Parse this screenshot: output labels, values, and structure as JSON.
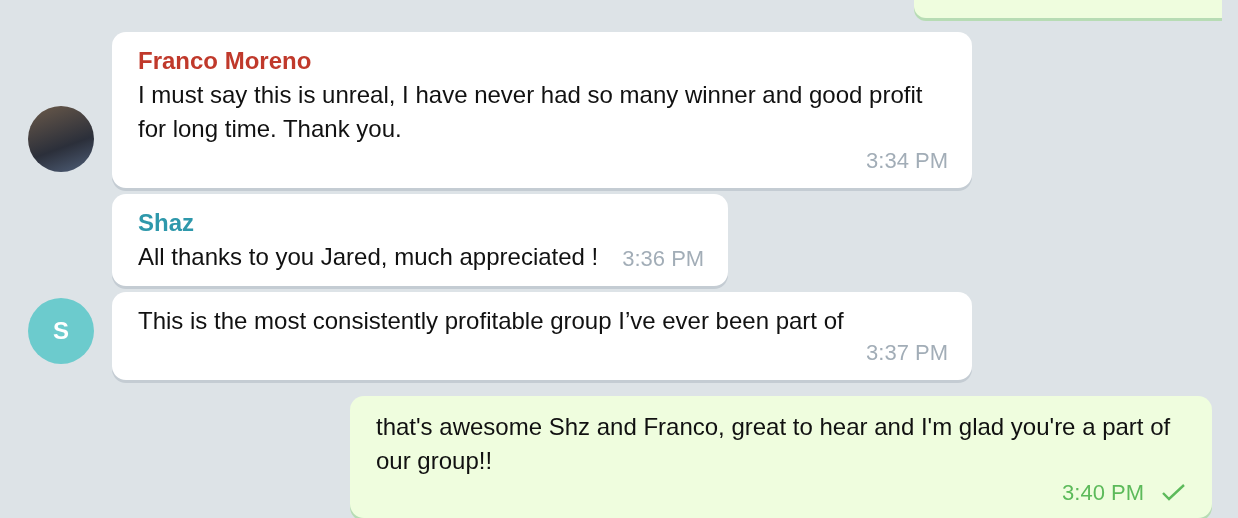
{
  "messages": [
    {
      "kind": "incoming",
      "sender": "Franco Moreno",
      "color": "#c0392b",
      "avatar": {
        "kind": "photo"
      },
      "text": "I must say this is unreal, I have never had so many winner and good profit for long time. Thank you.",
      "time": "3:34 PM"
    },
    {
      "kind": "incoming",
      "sender": "Shaz",
      "color": "#2e98ab",
      "text": "All thanks to you Jared, much appreciated !",
      "time": "3:36 PM"
    },
    {
      "kind": "incoming",
      "avatar": {
        "kind": "letter",
        "letter": "S",
        "color": "#6ccbcd"
      },
      "text": "This is the most consistently profitable group I’ve ever been part of",
      "time": "3:37 PM"
    },
    {
      "kind": "outgoing",
      "text": "that's awesome Shz and Franco, great to hear and I'm glad you're a part of our group!!",
      "time": "3:40 PM",
      "read": false
    }
  ]
}
